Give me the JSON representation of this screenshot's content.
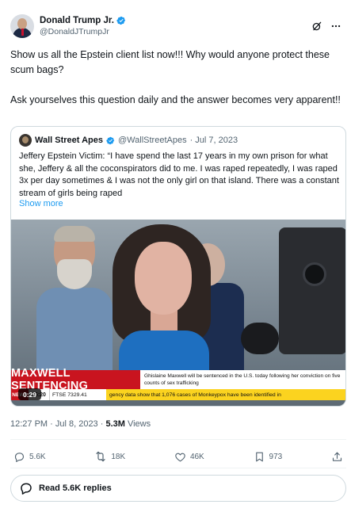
{
  "author": {
    "display_name": "Donald Trump Jr.",
    "handle": "@DonaldJTrumpJr",
    "verified_color": "#1d9bf0"
  },
  "tweet": {
    "paragraphs": [
      "Show us all the Epstein client list now!!! Why would anyone protect these scum bags?",
      "Ask yourselves this question daily and the answer becomes very apparent!!"
    ]
  },
  "quote": {
    "name": "Wall Street Apes",
    "handle": "@WallStreetApes",
    "date": "· Jul 7, 2023",
    "text": "Jeffery Epstein Victim: “I have spend the last 17 years in my own prison for what she, Jeffery & all the coconspirators did to me. I was raped repeatedly, I was raped 3x per day sometimes & I was not the only girl on that island. There was a constant stream of girls being raped",
    "show_more": "Show more",
    "video": {
      "duration": "0:29",
      "headline": "MAXWELL SENTENCING",
      "strap": "Ghislaine Maxwell will be sentenced in the U.S. today following her conviction on five counts of sex trafficking",
      "channel_bug": "NEWS",
      "clock": "16:20",
      "market": "FTSE 7329.41",
      "ticker": "gency data show that 1,076 cases of Monkeypox have been identified in"
    }
  },
  "meta": {
    "timestamp": "12:27 PM · Jul 8, 2023 · ",
    "views_count": "5.3M",
    "views_label": " Views"
  },
  "actions": {
    "replies": "5.6K",
    "reposts": "18K",
    "likes": "46K",
    "bookmarks": "973"
  },
  "read_replies": "Read 5.6K replies",
  "colors": {
    "accent": "#1d9bf0",
    "secondary_text": "#536471",
    "border": "#cfd9de",
    "headline_red": "#c9141f",
    "ticker_yellow": "#fbd31f"
  },
  "icons": [
    "verified-badge-icon",
    "grok-icon",
    "more-icon",
    "reply-icon",
    "repost-icon",
    "like-icon",
    "bookmark-icon",
    "share-icon",
    "chat-bubble-icon"
  ]
}
